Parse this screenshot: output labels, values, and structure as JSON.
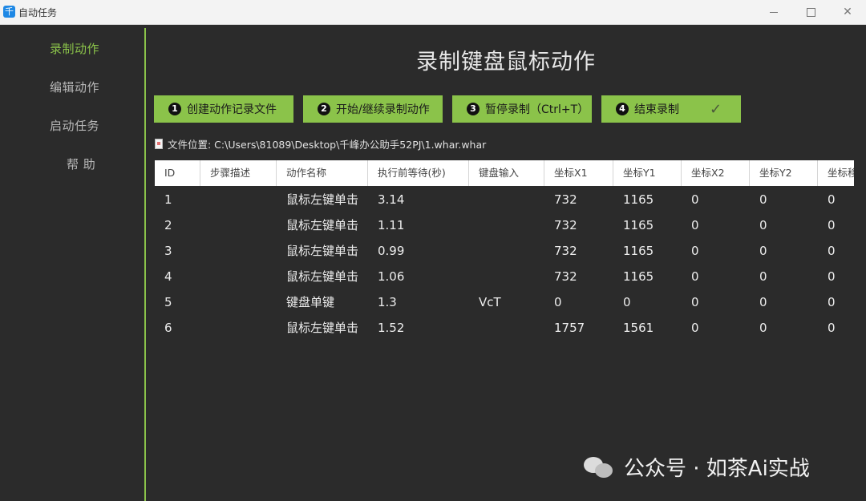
{
  "window": {
    "title": "自动任务",
    "icon_glyph": "千",
    "minimize_icon": "minimize-icon",
    "maximize_icon": "maximize-icon",
    "close_glyph": "✕"
  },
  "sidebar": {
    "items": [
      {
        "label": "录制动作",
        "active": true
      },
      {
        "label": "编辑动作",
        "active": false
      },
      {
        "label": "启动任务",
        "active": false
      },
      {
        "label": "帮 助",
        "active": false
      }
    ]
  },
  "main": {
    "title": "录制键盘鼠标动作",
    "buttons": [
      {
        "num": "1",
        "label": "创建动作记录文件"
      },
      {
        "num": "2",
        "label": "开始/继续录制动作"
      },
      {
        "num": "3",
        "label": "暂停录制（Ctrl+T）"
      },
      {
        "num": "4",
        "label": "结束录制",
        "check": "✓"
      }
    ],
    "file_path": "文件位置: C:\\Users\\81089\\Desktop\\千峰办公助手52PJ\\1.whar.whar"
  },
  "table": {
    "columns": [
      "ID",
      "步骤描述",
      "动作名称",
      "执行前等待(秒)",
      "键盘输入",
      "坐标X1",
      "坐标Y1",
      "坐标X2",
      "坐标Y2",
      "坐标移"
    ],
    "rows": [
      [
        "1",
        "",
        "鼠标左键单击",
        "3.14",
        "",
        "732",
        "1165",
        "0",
        "0",
        "0"
      ],
      [
        "2",
        "",
        "鼠标左键单击",
        "1.11",
        "",
        "732",
        "1165",
        "0",
        "0",
        "0"
      ],
      [
        "3",
        "",
        "鼠标左键单击",
        "0.99",
        "",
        "732",
        "1165",
        "0",
        "0",
        "0"
      ],
      [
        "4",
        "",
        "鼠标左键单击",
        "1.06",
        "",
        "732",
        "1165",
        "0",
        "0",
        "0"
      ],
      [
        "5",
        "",
        "键盘单键",
        "1.3",
        "VcT",
        "0",
        "0",
        "0",
        "0",
        "0"
      ],
      [
        "6",
        "",
        "鼠标左键单击",
        "1.52",
        "",
        "1757",
        "1561",
        "0",
        "0",
        "0"
      ]
    ]
  },
  "watermark": {
    "text": "公众号 · 如茶Ai实战",
    "icon": "wechat-icon"
  },
  "colors": {
    "accent": "#8bc34a",
    "background": "#2b2b2b"
  }
}
